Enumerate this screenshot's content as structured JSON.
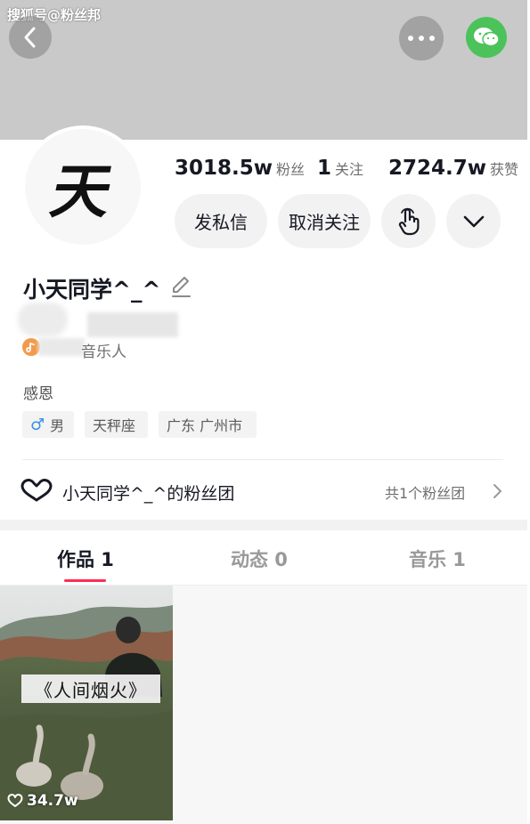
{
  "watermark": "搜狐号@粉丝邦",
  "profile": {
    "avatar_char": "天",
    "nickname": "小天同学^_^",
    "role_label": "音乐人",
    "bio": "感恩",
    "tags": {
      "gender": "男",
      "zodiac": "天秤座",
      "location": "广东 广州市"
    }
  },
  "stats": {
    "fans": {
      "value": "3018.5w",
      "label": "粉丝"
    },
    "following": {
      "value": "1",
      "label": "关注"
    },
    "likes": {
      "value": "2724.7w",
      "label": "获赞"
    }
  },
  "actions": {
    "message": "发私信",
    "unfollow": "取消关注"
  },
  "fan_club": {
    "title": "小天同学^_^的粉丝团",
    "count": "共1个粉丝团"
  },
  "tabs": [
    {
      "label": "作品 1",
      "active": true
    },
    {
      "label": "动态 0",
      "active": false
    },
    {
      "label": "音乐 1",
      "active": false
    }
  ],
  "videos": [
    {
      "title": "《人间烟火》",
      "likes": "34.7w"
    }
  ],
  "colors": {
    "accent": "#fe2c55",
    "wechat": "#4cc35a",
    "music_badge": "#f39a4a",
    "gender_male": "#3a8ee8"
  },
  "icons": [
    "back-icon",
    "more-dots-icon",
    "wechat-icon",
    "touch-icon",
    "chevron-down-icon",
    "edit-icon",
    "music-note-icon",
    "male-icon",
    "heart-outline-icon",
    "chevron-right-icon",
    "heart-icon"
  ]
}
